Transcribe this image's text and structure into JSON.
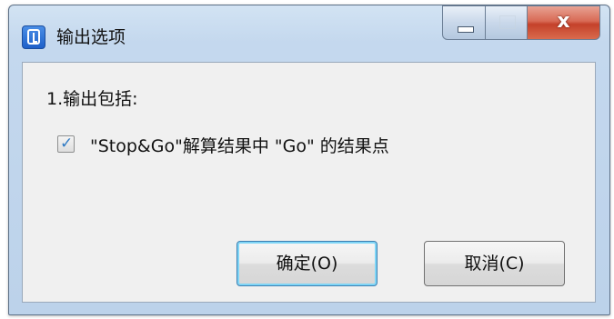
{
  "window": {
    "title": "输出选项",
    "icon": "app-logo-icon",
    "close_glyph": "x"
  },
  "options": {
    "section_label": "1.输出包括:",
    "checkbox_checked": true,
    "checkbox_label": "\"Stop&Go\"解算结果中 \"Go\" 的结果点"
  },
  "buttons": {
    "ok_label": "确定(O)",
    "cancel_label": "取消(C)"
  },
  "colors": {
    "title_bar": "#c4d8ee",
    "close_button": "#c4412a",
    "client_bg": "#f0f0f0",
    "default_button_glow": "#7fd5f6"
  }
}
